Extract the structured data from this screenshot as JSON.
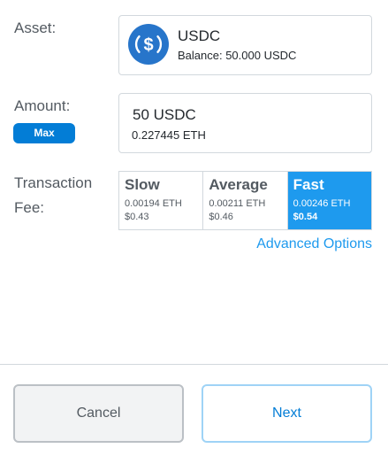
{
  "asset": {
    "label": "Asset:",
    "token_name": "USDC",
    "balance": "Balance: 50.000 USDC",
    "icon": "usdc-icon"
  },
  "amount": {
    "label": "Amount:",
    "max_label": "Max",
    "value": "50 USDC",
    "eth_equivalent": "0.227445 ETH"
  },
  "fee": {
    "label_line1": "Transaction",
    "label_line2": "Fee:",
    "options": [
      {
        "name": "Slow",
        "eth": "0.00194 ETH",
        "usd": "$0.43",
        "selected": false
      },
      {
        "name": "Average",
        "eth": "0.00211 ETH",
        "usd": "$0.46",
        "selected": false
      },
      {
        "name": "Fast",
        "eth": "0.00246 ETH",
        "usd": "$0.54",
        "selected": true
      }
    ],
    "advanced_label": "Advanced Options"
  },
  "actions": {
    "cancel_label": "Cancel",
    "next_label": "Next"
  },
  "colors": {
    "accent": "#1e9aee",
    "primary": "#037dd6",
    "usdc_blue": "#2775ca"
  }
}
